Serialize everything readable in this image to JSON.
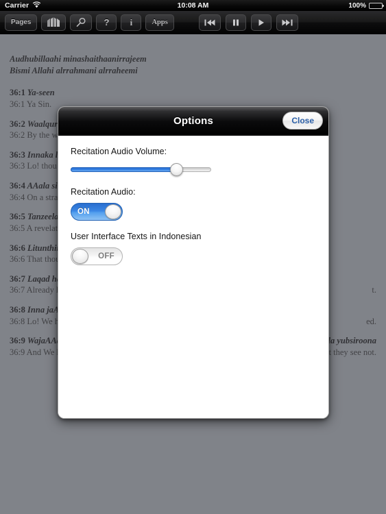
{
  "status_bar": {
    "carrier": "Carrier",
    "wifi_icon": "wifi-icon",
    "time": "10:08 AM",
    "battery_percent": "100%",
    "battery_icon": "battery-full-icon"
  },
  "toolbar": {
    "buttons": [
      {
        "label": "Pages",
        "name": "pages-button",
        "icon": null
      },
      {
        "label": "",
        "name": "bookmark-button",
        "icon": "bookmark-icon"
      },
      {
        "label": "",
        "name": "search-button",
        "icon": "magnifier-icon"
      },
      {
        "label": "?",
        "name": "help-button",
        "icon": "question-mark-icon"
      },
      {
        "label": "i",
        "name": "info-button",
        "icon": "info-icon"
      },
      {
        "label": "Apps",
        "name": "apps-button",
        "icon": null
      }
    ],
    "playback": [
      {
        "label": "",
        "name": "previous-track-button",
        "icon": "skip-back-icon"
      },
      {
        "label": "",
        "name": "pause-button",
        "icon": "pause-icon"
      },
      {
        "label": "",
        "name": "play-button",
        "icon": "play-icon"
      },
      {
        "label": "",
        "name": "next-track-button",
        "icon": "skip-forward-icon"
      }
    ]
  },
  "page": {
    "basmala": [
      "Audhubillaahi minashaithaanirrajeem",
      "Bismi Allahi alrrahmani alrraheemi"
    ],
    "verses": [
      {
        "num": "36:1",
        "translit": "Ya-seen",
        "translation": "36:1 Ya Sin.",
        "translit_tail": "",
        "translation_tail": ""
      },
      {
        "num": "36:2",
        "translit": "Waalqur-a",
        "translation": "36:2 By the wisd",
        "translit_tail": "",
        "translation_tail": ""
      },
      {
        "num": "36:3",
        "translit": "Innaka lam",
        "translation": "36:3 Lo! thou ar",
        "translit_tail": "",
        "translation_tail": ""
      },
      {
        "num": "36:4",
        "translit": "AAala sira",
        "translation": "36:4 On a straigh",
        "translit_tail": "",
        "translation_tail": ""
      },
      {
        "num": "36:5",
        "translit": "Tanzeela a",
        "translation": "36:5 A revelatio",
        "translit_tail": "",
        "translation_tail": ""
      },
      {
        "num": "36:6",
        "translit": "Litunthira",
        "translation": "36:6 That thou m",
        "translit_tail": "",
        "translation_tail": ""
      },
      {
        "num": "36:7",
        "translit": "Laqad haqq",
        "translation": "36:7 Already hat",
        "translit_tail": "",
        "translation_tail": "t."
      },
      {
        "num": "36:8",
        "translit": "Inna jaAAa",
        "translation": "36:8 Lo! We have",
        "translit_tail": "",
        "translation_tail": "ed."
      },
      {
        "num": "36:9",
        "translit": "WajaAAaln",
        "translation": "36:9 And We hav",
        "translit_tail": "la yubsiroona",
        "translation_tail": "t they see not."
      }
    ]
  },
  "modal": {
    "title": "Options",
    "close_label": "Close",
    "volume": {
      "label": "Recitation Audio Volume:",
      "value": 78,
      "min": 0,
      "max": 100
    },
    "recitation_audio": {
      "label": "Recitation Audio:",
      "state": "ON"
    },
    "indonesian_texts": {
      "label": "User Interface Texts in Indonesian",
      "state": "OFF"
    }
  },
  "colors": {
    "accent_blue": "#3b87e4",
    "close_text": "#2b5fa8",
    "page_background": "#808389",
    "toolbar_dark": "#161617"
  }
}
